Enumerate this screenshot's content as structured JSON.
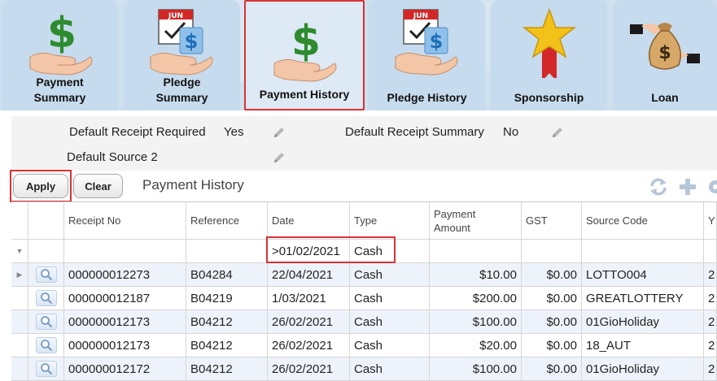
{
  "tabs": [
    {
      "label_line1": "Payment",
      "label_line2": "Summary",
      "icon": "money-hand-icon",
      "selected": false
    },
    {
      "label_line1": "Pledge",
      "label_line2": "Summary",
      "icon": "calendar-money-hand-icon",
      "selected": false
    },
    {
      "label_line1": "Payment History",
      "label_line2": "",
      "icon": "money-hand-icon",
      "selected": true
    },
    {
      "label_line1": "Pledge History",
      "label_line2": "",
      "icon": "calendar-money-hand-icon",
      "selected": false
    },
    {
      "label_line1": "Sponsorship",
      "label_line2": "",
      "icon": "star-ribbon-icon",
      "selected": false
    },
    {
      "label_line1": "Loan",
      "label_line2": "",
      "icon": "money-bag-hands-icon",
      "selected": false
    }
  ],
  "calendar_month": "JUN",
  "defaults": {
    "receipt_required_label": "Default Receipt Required",
    "receipt_required_value": "Yes",
    "receipt_summary_label": "Default Receipt Summary",
    "receipt_summary_value": "No",
    "source_label": "Default Source 2",
    "source_value": ""
  },
  "toolbar": {
    "apply_label": "Apply",
    "clear_label": "Clear",
    "title": "Payment History",
    "icons": [
      "refresh-icon",
      "add-icon",
      "settings-icon"
    ]
  },
  "grid": {
    "columns": [
      {
        "key": "receipt_no",
        "label": "Receipt No"
      },
      {
        "key": "reference",
        "label": "Reference"
      },
      {
        "key": "date",
        "label": "Date"
      },
      {
        "key": "type",
        "label": "Type"
      },
      {
        "key": "amount",
        "label_line1": "Payment",
        "label_line2": "Amount"
      },
      {
        "key": "gst",
        "label": "GST"
      },
      {
        "key": "source_code",
        "label": "Source Code"
      },
      {
        "key": "next",
        "label": "Y"
      }
    ],
    "filter": {
      "date": ">01/02/2021",
      "type": "Cash"
    },
    "rows": [
      {
        "receipt_no": "000000012273",
        "reference": "B04284",
        "date": "22/04/2021",
        "type": "Cash",
        "amount": "$10.00",
        "gst": "$0.00",
        "source_code": "LOTTO004",
        "next": "2"
      },
      {
        "receipt_no": "000000012187",
        "reference": "B04219",
        "date": "1/03/2021",
        "type": "Cash",
        "amount": "$200.00",
        "gst": "$0.00",
        "source_code": "GREATLOTTERY",
        "next": "2"
      },
      {
        "receipt_no": "000000012173",
        "reference": "B04212",
        "date": "26/02/2021",
        "type": "Cash",
        "amount": "$100.00",
        "gst": "$0.00",
        "source_code": "01GioHoliday",
        "next": "2"
      },
      {
        "receipt_no": "000000012173",
        "reference": "B04212",
        "date": "26/02/2021",
        "type": "Cash",
        "amount": "$20.00",
        "gst": "$0.00",
        "source_code": "18_AUT",
        "next": "2"
      },
      {
        "receipt_no": "000000012172",
        "reference": "B04212",
        "date": "26/02/2021",
        "type": "Cash",
        "amount": "$100.00",
        "gst": "$0.00",
        "source_code": "01GioHoliday",
        "next": "2"
      }
    ]
  },
  "colors": {
    "accent_red": "#d93333",
    "tab_bg": "#c6dbed",
    "money_green": "#2e8b2e",
    "row_alt": "#eef3fb"
  }
}
